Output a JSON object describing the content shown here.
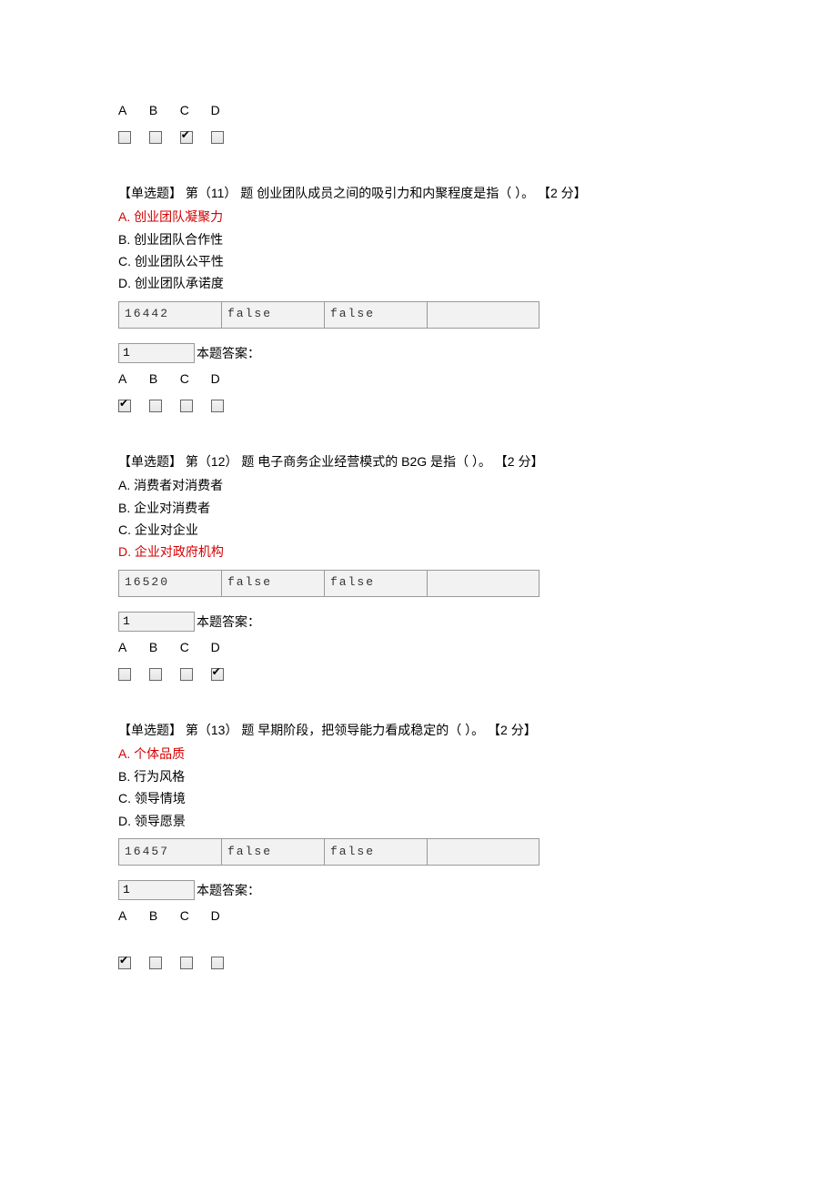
{
  "labels": {
    "A": "A",
    "B": "B",
    "C": "C",
    "D": "D"
  },
  "answer_label": "本题答案：",
  "topBlock": {
    "checked": "C"
  },
  "q11": {
    "title": "【单选题】 第（11） 题  创业团队成员之间的吸引力和内聚程度是指（ ）。 【2 分】",
    "opts": {
      "A": "A.  创业团队凝聚力",
      "B": "B.  创业团队合作性",
      "C": "C.  创业团队公平性",
      "D": "D.  创业团队承诺度"
    },
    "correct": "A",
    "table": {
      "c1": "16442",
      "c2": "false",
      "c3": "false",
      "c4": ""
    },
    "small": "1",
    "checked": "A"
  },
  "q12": {
    "title": "【单选题】 第（12） 题  电子商务企业经营模式的 B2G 是指（ ）。 【2 分】",
    "opts": {
      "A": "A.  消费者对消费者",
      "B": "B.  企业对消费者",
      "C": "C.  企业对企业",
      "D": "D.  企业对政府机构"
    },
    "correct": "D",
    "table": {
      "c1": "16520",
      "c2": "false",
      "c3": "false",
      "c4": ""
    },
    "small": "1",
    "checked": "D"
  },
  "q13": {
    "title": "【单选题】 第（13） 题  早期阶段，把领导能力看成稳定的（ ）。 【2 分】",
    "opts": {
      "A": "A.  个体品质",
      "B": "B.  行为风格",
      "C": "C.  领导情境",
      "D": "D.  领导愿景"
    },
    "correct": "A",
    "table": {
      "c1": "16457",
      "c2": "false",
      "c3": "false",
      "c4": ""
    },
    "small": "1",
    "checked": "A"
  }
}
